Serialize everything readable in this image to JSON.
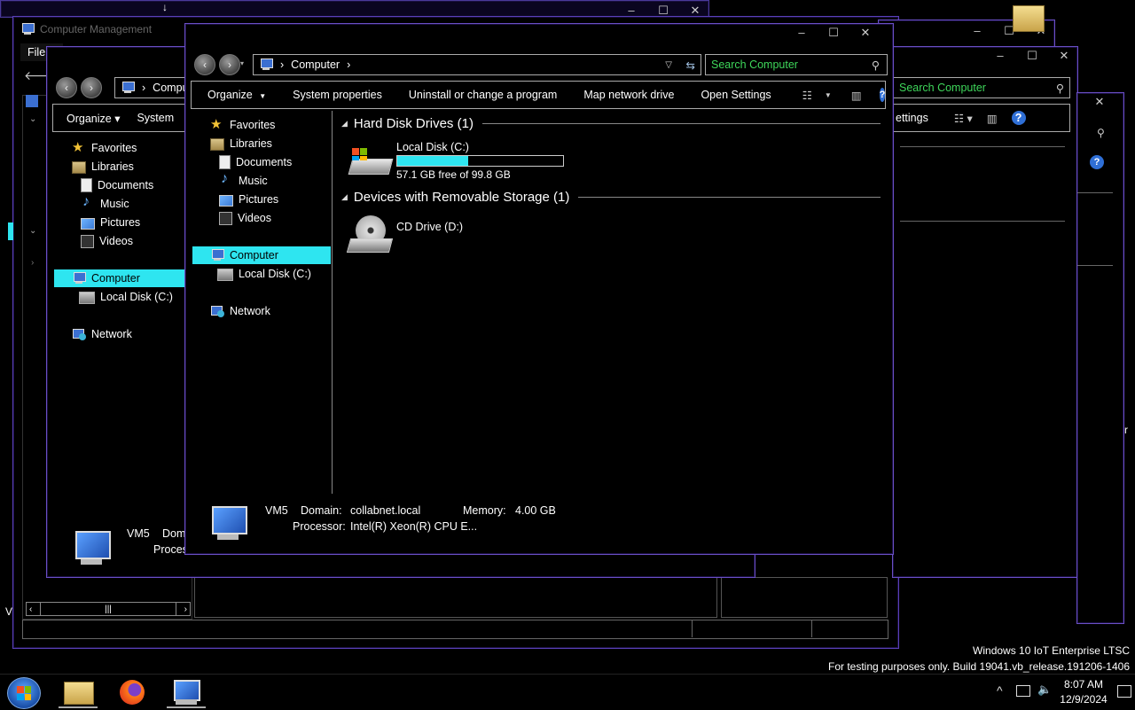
{
  "background_windows": {
    "top_window": {
      "controls": [
        "–",
        "☐",
        "✕"
      ]
    },
    "mgmt_window": {
      "title": "Computer Management",
      "menu_file": "File",
      "controls": [
        "–",
        "☐",
        "✕"
      ]
    },
    "right_window_1": {
      "controls": [
        "–",
        "☐",
        "✕"
      ],
      "search_placeholder": "Search Computer"
    },
    "right_window_2": {
      "controls": [
        "–",
        "☐",
        "✕"
      ],
      "toolbar_settings": "ettings"
    },
    "right_window_3": {
      "controls": [
        "✕"
      ]
    }
  },
  "mid_window": {
    "address": "Compu",
    "toolbar": {
      "organize": "Organize ▾",
      "system": "System"
    },
    "nav": {
      "favorites": "Favorites",
      "libraries": "Libraries",
      "documents": "Documents",
      "music": "Music",
      "pictures": "Pictures",
      "videos": "Videos",
      "computer": "Computer",
      "local_disk": "Local Disk (C:)",
      "network": "Network"
    },
    "details": {
      "name": "VM5",
      "domain_label": "Dom",
      "processor_label": "Proces"
    }
  },
  "main_window": {
    "controls": [
      "–",
      "☐",
      "✕"
    ],
    "address": {
      "path": [
        "Computer"
      ]
    },
    "search_placeholder": "Search Computer",
    "toolbar": {
      "organize": "Organize",
      "system_properties": "System properties",
      "uninstall": "Uninstall or change a program",
      "map_drive": "Map network drive",
      "open_settings": "Open Settings"
    },
    "nav": {
      "favorites": "Favorites",
      "libraries": "Libraries",
      "documents": "Documents",
      "music": "Music",
      "pictures": "Pictures",
      "videos": "Videos",
      "computer": "Computer",
      "local_disk": "Local Disk (C:)",
      "network": "Network"
    },
    "sections": {
      "hard_disks": "Hard Disk Drives (1)",
      "removable": "Devices with Removable Storage (1)"
    },
    "drives": {
      "c_name": "Local Disk (C:)",
      "c_free": "57.1 GB free of 99.8 GB",
      "c_used_fraction": 0.428,
      "d_name": "CD Drive (D:)"
    },
    "details": {
      "name": "VM5",
      "domain_label": "Domain:",
      "domain_value": "collabnet.local",
      "memory_label": "Memory:",
      "memory_value": "4.00 GB",
      "processor_label": "Processor:",
      "processor_value": "Intel(R) Xeon(R) CPU E..."
    }
  },
  "desktop": {
    "watermark_line1": "Windows 10 IoT Enterprise LTSC",
    "watermark_line2": "For testing purposes only. Build 19041.vb_release.191206-1406",
    "edge_char": "r",
    "left_edge_char": "V"
  },
  "taskbar": {
    "time": "8:07 AM",
    "date": "12/9/2024",
    "tray_up": "^"
  },
  "colors": {
    "selection": "#2ee5f0",
    "search_text": "#3ed65a",
    "window_border": "#6a4fc4"
  }
}
